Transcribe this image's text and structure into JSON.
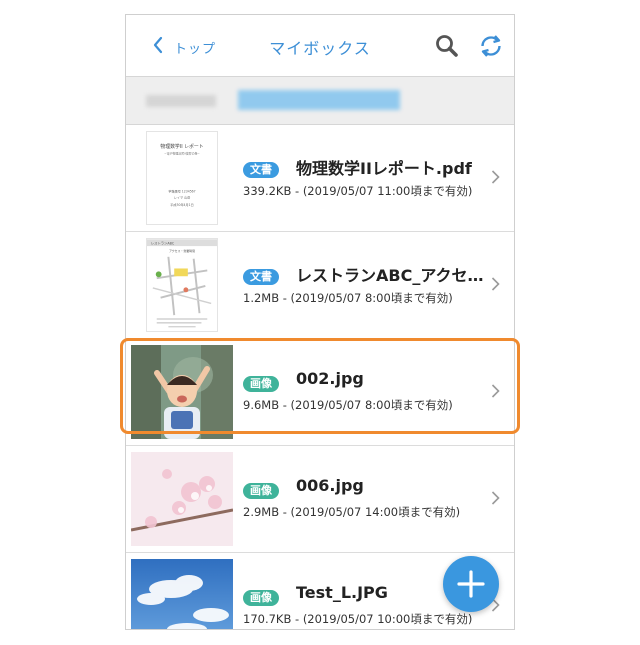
{
  "header": {
    "back_label": "トップ",
    "title": "マイボックス",
    "search_icon": "search-icon",
    "refresh_icon": "refresh-icon"
  },
  "colors": {
    "accent": "#3d8fd6",
    "badge_document": "#3b9be0",
    "badge_image": "#3fb39a",
    "highlight": "#f08a2e",
    "fab": "#3a97df"
  },
  "files": [
    {
      "badge": "文書",
      "badge_type": "document",
      "name": "物理数学IIレポート.pdf",
      "meta": "339.2KB - (2019/05/07 11:00頃まで有効)",
      "thumb_title": "物理数学II レポート",
      "thumb_subtitle": "~電子物理演習II復習の巻~",
      "thumb_lines": [
        "学籍番号 1234567",
        "レイマ 山岳",
        "平成30年4月1日"
      ]
    },
    {
      "badge": "文書",
      "badge_type": "document",
      "name": "レストランABC_アクセス.pdf",
      "meta": "1.2MB - (2019/05/07 8:00頃まで有効)",
      "thumb_title": "レストランABC",
      "thumb_subtitle": "アクセス・営業時間"
    },
    {
      "badge": "画像",
      "badge_type": "image",
      "name": "002.jpg",
      "meta": "9.6MB - (2019/05/07 8:00頃まで有効)"
    },
    {
      "badge": "画像",
      "badge_type": "image",
      "name": "006.jpg",
      "meta": "2.9MB - (2019/05/07 14:00頃まで有効)"
    },
    {
      "badge": "画像",
      "badge_type": "image",
      "name": "Test_L.JPG",
      "meta": "170.7KB - (2019/05/07 10:00頃まで有効)"
    }
  ],
  "fab": {
    "icon": "plus-icon"
  }
}
